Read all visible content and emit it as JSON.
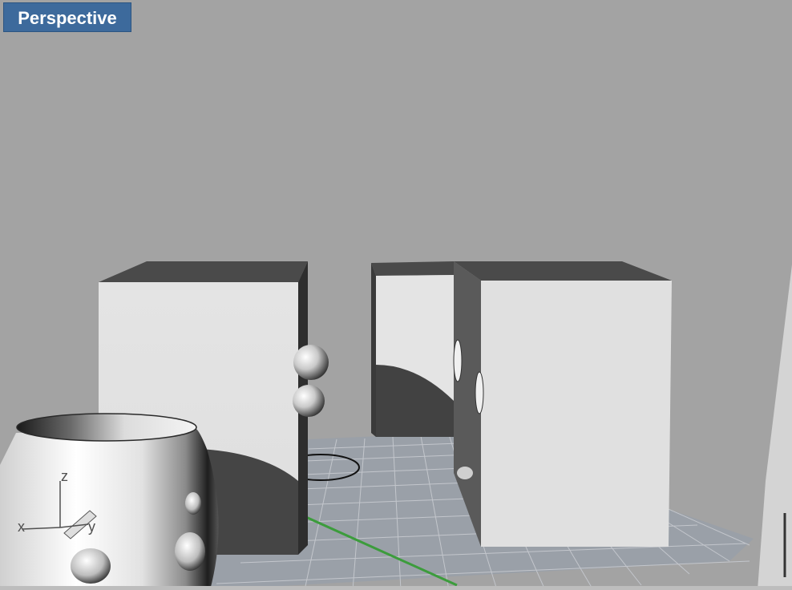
{
  "viewport": {
    "title": "Perspective",
    "background": "#a3a3a3",
    "title_bg": "#3d6a9c",
    "active": true
  },
  "axes": {
    "x_label": "x",
    "y_label": "y",
    "z_label": "z",
    "x_axis_color": "#c83232",
    "y_axis_color": "#3c9c3c"
  },
  "scene": {
    "objects": [
      "box-left",
      "box-back",
      "box-right",
      "sphere-upper",
      "sphere-lower",
      "circle-curve",
      "vase",
      "grid-plane"
    ]
  }
}
